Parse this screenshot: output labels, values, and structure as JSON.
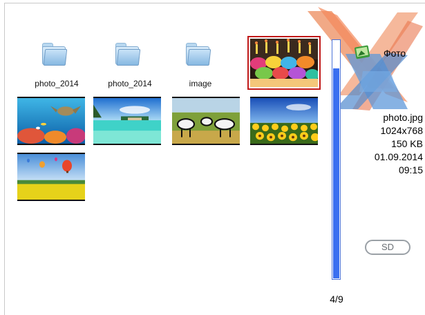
{
  "browser": {
    "items": [
      {
        "type": "folder",
        "label": "photo_2014"
      },
      {
        "type": "folder",
        "label": "photo_2014"
      },
      {
        "type": "folder",
        "label": "image"
      },
      {
        "type": "image",
        "subject": "birthday-cupcakes",
        "selected": true
      },
      {
        "type": "image",
        "subject": "coral-reef-turtle"
      },
      {
        "type": "image",
        "subject": "tropical-beach"
      },
      {
        "type": "image",
        "subject": "zebras-savanna"
      },
      {
        "type": "image",
        "subject": "sunflower-field"
      },
      {
        "type": "image",
        "subject": "hot-air-balloons"
      }
    ],
    "scroll_fraction": 0.88
  },
  "section": {
    "title": "Фото",
    "icon": "photo-album-icon"
  },
  "file_info": {
    "name": "photo.jpg",
    "resolution": "1024x768",
    "size": "150 KB",
    "date": "01.09.2014",
    "time": "09:15"
  },
  "storage": {
    "label": "SD"
  },
  "position": {
    "counter": "4/9"
  },
  "colors": {
    "selection": "#c01818",
    "scrollbar": "#3a6ff0",
    "logo_orange": "#f08a5d",
    "logo_blue": "#4a86c8"
  }
}
